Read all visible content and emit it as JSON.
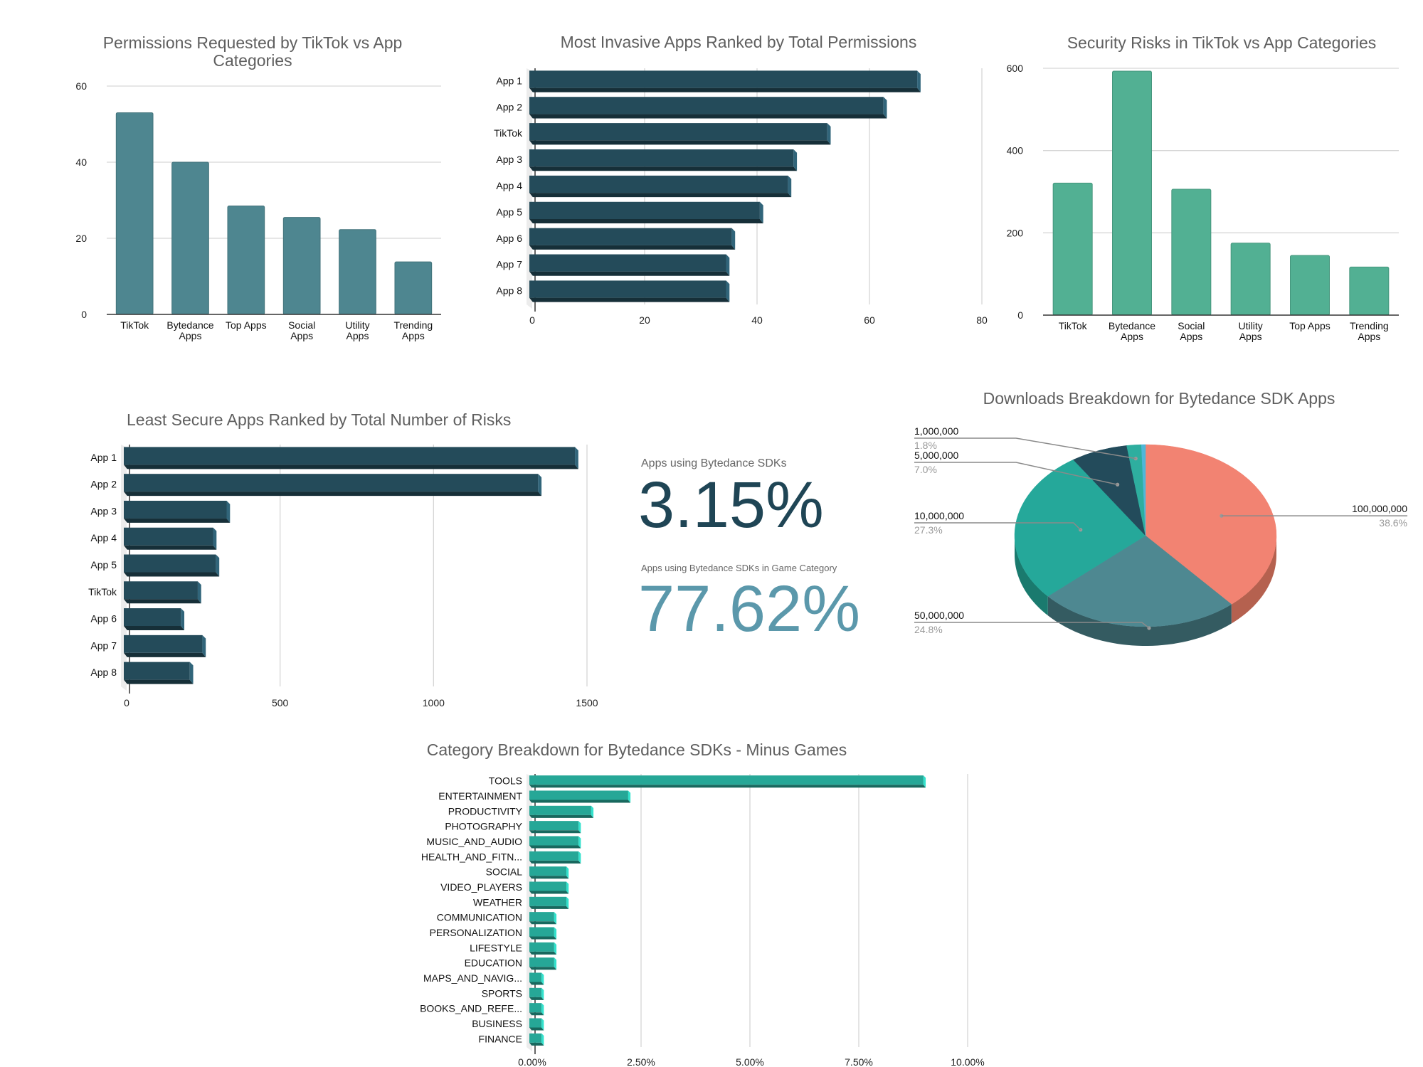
{
  "colors": {
    "permissions_bar": "#4E8690",
    "risk_bar": "#52B093",
    "rank_bar": "#244B5A",
    "category_bar": "#26A797",
    "kpi_primary": "#1F4555",
    "kpi_secondary": "#5B98AB"
  },
  "kpis": [
    {
      "label": "Apps using Bytedance SDKs",
      "value": "3.15%"
    },
    {
      "label": "Apps using Bytedance SDKs in Game Category",
      "value": "77.62%"
    }
  ],
  "chart_data": [
    {
      "id": "permissions",
      "type": "bar",
      "title": "Permissions Requested by TikTok vs App Categories",
      "title_lines": [
        "Permissions Requested by TikTok vs App",
        "Categories"
      ],
      "categories": [
        "TikTok",
        "Bytedance Apps",
        "Top Apps",
        "Social Apps",
        "Utility Apps",
        "Trending Apps"
      ],
      "category_lines": [
        [
          "TikTok"
        ],
        [
          "Bytedance",
          "Apps"
        ],
        [
          "Top Apps"
        ],
        [
          "Social",
          "Apps"
        ],
        [
          "Utility",
          "Apps"
        ],
        [
          "Trending",
          "Apps"
        ]
      ],
      "values": [
        53,
        40,
        28.5,
        25.5,
        22.3,
        13.8
      ],
      "ylim": [
        0,
        60
      ],
      "yticks": [
        0,
        20,
        40,
        60
      ],
      "xlabel": "",
      "ylabel": "",
      "grid": true,
      "legend": "none"
    },
    {
      "id": "invasive",
      "type": "bar",
      "orientation": "horizontal",
      "title": "Most Invasive Apps Ranked by Total Permissions",
      "categories": [
        "App 1",
        "App 2",
        "TikTok",
        "App 3",
        "App 4",
        "App 5",
        "App 6",
        "App 7",
        "App 8"
      ],
      "values": [
        69,
        63,
        53,
        47,
        46,
        41,
        36,
        35,
        35
      ],
      "xlim": [
        0,
        80
      ],
      "xticks": [
        0,
        20,
        40,
        60,
        80
      ],
      "xlabel": "",
      "ylabel": "",
      "grid": true,
      "legend": "none"
    },
    {
      "id": "security",
      "type": "bar",
      "title": "Security Risks in TikTok vs App Categories",
      "categories": [
        "TikTok",
        "Bytedance Apps",
        "Social Apps",
        "Utility Apps",
        "Top Apps",
        "Trending Apps"
      ],
      "category_lines": [
        [
          "TikTok"
        ],
        [
          "Bytedance",
          "Apps"
        ],
        [
          "Social",
          "Apps"
        ],
        [
          "Utility",
          "Apps"
        ],
        [
          "Top Apps"
        ],
        [
          "Trending",
          "Apps"
        ]
      ],
      "values": [
        321,
        593,
        306,
        175,
        145,
        117
      ],
      "ylim": [
        0,
        600
      ],
      "yticks": [
        0,
        200,
        400,
        600
      ],
      "xlabel": "",
      "ylabel": "",
      "grid": true,
      "legend": "none"
    },
    {
      "id": "least_secure",
      "type": "bar",
      "orientation": "horizontal",
      "title": "Least Secure Apps Ranked by Total Number of Risks",
      "categories": [
        "App 1",
        "App 2",
        "App 3",
        "App 4",
        "App 5",
        "TikTok",
        "App 6",
        "App 7",
        "App 8"
      ],
      "values": [
        1470,
        1350,
        335,
        291,
        300,
        241,
        186,
        256,
        215
      ],
      "xlim": [
        0,
        1500
      ],
      "xticks": [
        0,
        500,
        1000,
        1500
      ],
      "xlabel": "",
      "ylabel": "",
      "grid": true,
      "legend": "none"
    },
    {
      "id": "downloads",
      "type": "pie",
      "title": "Downloads Breakdown for Bytedance SDK Apps",
      "slices": [
        {
          "label": "100,000,000",
          "percent": 38.6,
          "pct_text": "38.6%",
          "color": "#F28372",
          "side": "#B5614F"
        },
        {
          "label": "50,000,000",
          "percent": 24.8,
          "pct_text": "24.8%",
          "color": "#4E8891",
          "side": "#345B61"
        },
        {
          "label": "10,000,000",
          "percent": 27.3,
          "pct_text": "27.3%",
          "color": "#25A89A",
          "side": "#1A7A6E"
        },
        {
          "label": "5,000,000",
          "percent": 7.0,
          "pct_text": "7.0%",
          "color": "#234B5B",
          "side": "#183440"
        },
        {
          "label": "1,000,000",
          "percent": 1.8,
          "pct_text": "1.8%",
          "color": "#2EAE9F",
          "side": "#1F7D72"
        },
        {
          "label": "",
          "percent": 0.5,
          "pct_text": "",
          "color": "#4FB7D8",
          "side": "#3A8AA3"
        }
      ],
      "legend": "none"
    },
    {
      "id": "category",
      "type": "bar",
      "orientation": "horizontal",
      "title": "Category Breakdown for Bytedance SDKs - Minus Games",
      "categories": [
        "TOOLS",
        "ENTERTAINMENT",
        "PRODUCTIVITY",
        "PHOTOGRAPHY",
        "MUSIC_AND_AUDIO",
        "HEALTH_AND_FITN...",
        "SOCIAL",
        "VIDEO_PLAYERS",
        "WEATHER",
        "COMMUNICATION",
        "PERSONALIZATION",
        "LIFESTYLE",
        "EDUCATION",
        "MAPS_AND_NAVIG...",
        "SPORTS",
        "BOOKS_AND_REFE...",
        "BUSINESS",
        "FINANCE"
      ],
      "values": [
        9.05,
        2.27,
        1.42,
        1.13,
        1.13,
        1.13,
        0.85,
        0.85,
        0.85,
        0.57,
        0.57,
        0.57,
        0.57,
        0.28,
        0.28,
        0.28,
        0.28,
        0.28
      ],
      "unit": "%",
      "xlim": [
        0,
        10
      ],
      "xticks": [
        0,
        2.5,
        5,
        7.5,
        10
      ],
      "xtick_labels": [
        "0.00%",
        "2.50%",
        "5.00%",
        "7.50%",
        "10.00%"
      ],
      "xlabel": "",
      "ylabel": "",
      "grid": true,
      "legend": "none"
    }
  ]
}
